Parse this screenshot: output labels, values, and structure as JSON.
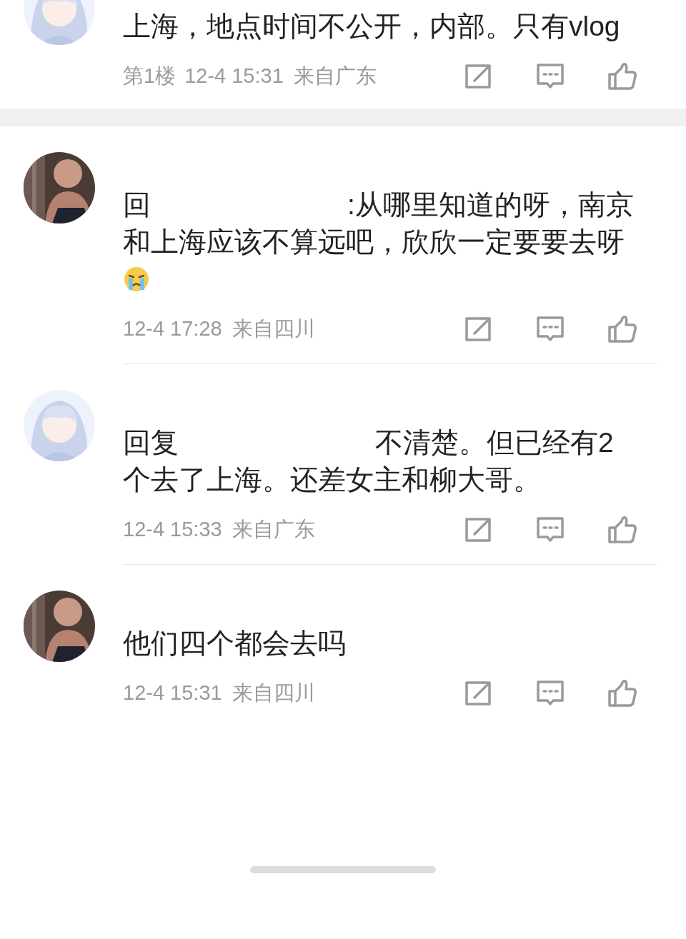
{
  "comments": [
    {
      "avatar": {
        "kind": "anime"
      },
      "segments": [
        {
          "kind": "text",
          "text": "上海，地点时间不公开，内部。只有vlog"
        }
      ],
      "floor": "第1楼",
      "time": "12-4 15:31",
      "location": "来自广东",
      "separator": {
        "kind": "section"
      }
    },
    {
      "avatar": {
        "kind": "photo"
      },
      "segments": [
        {
          "kind": "text",
          "text": "回"
        },
        {
          "kind": "redacted"
        },
        {
          "kind": "text",
          "text": ":从哪里知道的呀，南京和上海应该不算远吧，欣欣一定要要去呀"
        },
        {
          "kind": "emoji"
        }
      ],
      "time": "12-4 17:28",
      "location": "来自四川",
      "separator": {
        "kind": "line"
      }
    },
    {
      "avatar": {
        "kind": "anime"
      },
      "segments": [
        {
          "kind": "text",
          "text": "回复"
        },
        {
          "kind": "redacted"
        },
        {
          "kind": "text",
          "text": "不清楚。但已经有2个去了上海。还差女主和柳大哥。"
        }
      ],
      "time": "12-4 15:33",
      "location": "来自广东",
      "separator": {
        "kind": "line"
      }
    },
    {
      "avatar": {
        "kind": "photo"
      },
      "segments": [
        {
          "kind": "text",
          "text": "他们四个都会去吗"
        }
      ],
      "time": "12-4 15:31",
      "location": "来自四川"
    }
  ]
}
